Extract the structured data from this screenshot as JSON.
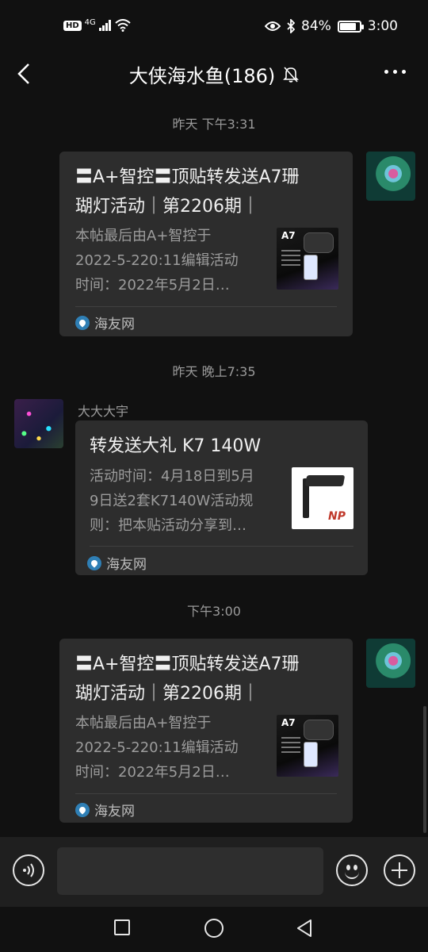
{
  "status_bar": {
    "hd": "HD",
    "network": "4G",
    "battery_percent": "84%",
    "battery_level": 0.84,
    "time": "3:00",
    "icons": [
      "signal-icon",
      "wifi-icon",
      "eye-icon",
      "bluetooth-icon",
      "battery-icon"
    ]
  },
  "header": {
    "title": "大侠海水鱼(186)",
    "icons": [
      "back-arrow-icon",
      "mute-bell-icon",
      "more-dots-icon"
    ]
  },
  "messages": [
    {
      "timestamp": "昨天 下午3:31",
      "side": "right",
      "card": {
        "title_line1": "〓A+智控〓顶贴转发送A7珊",
        "title_line2": "瑚灯活动｜第2206期｜",
        "desc_line1": "本帖最后由A+智控于",
        "desc_line2": "2022-5-220:11编辑活动",
        "desc_line3": "时间：2022年5月2日…",
        "thumb_label": "A7",
        "source": "海友网"
      }
    },
    {
      "timestamp": "昨天 晚上7:35",
      "side": "left",
      "sender": "大大大宇",
      "card": {
        "title_line1": "转发送大礼 K7 140W",
        "desc_line1": "活动时间：4月18日到5月",
        "desc_line2": "9日送2套K7140W活动规",
        "desc_line3": "则：把本贴活动分享到…",
        "thumb_label": "NP",
        "source": "海友网"
      }
    },
    {
      "timestamp": "下午3:00",
      "side": "right",
      "card": {
        "title_line1": "〓A+智控〓顶贴转发送A7珊",
        "title_line2": "瑚灯活动｜第2206期｜",
        "desc_line1": "本帖最后由A+智控于",
        "desc_line2": "2022-5-220:11编辑活动",
        "desc_line3": "时间：2022年5月2日…",
        "thumb_label": "A7",
        "source": "海友网"
      }
    }
  ],
  "input_bar": {
    "icons": [
      "voice-icon",
      "emoji-icon",
      "plus-icon"
    ],
    "text_value": ""
  },
  "nav_bar": {
    "icons": [
      "recent-apps-icon",
      "home-icon",
      "back-icon"
    ]
  }
}
